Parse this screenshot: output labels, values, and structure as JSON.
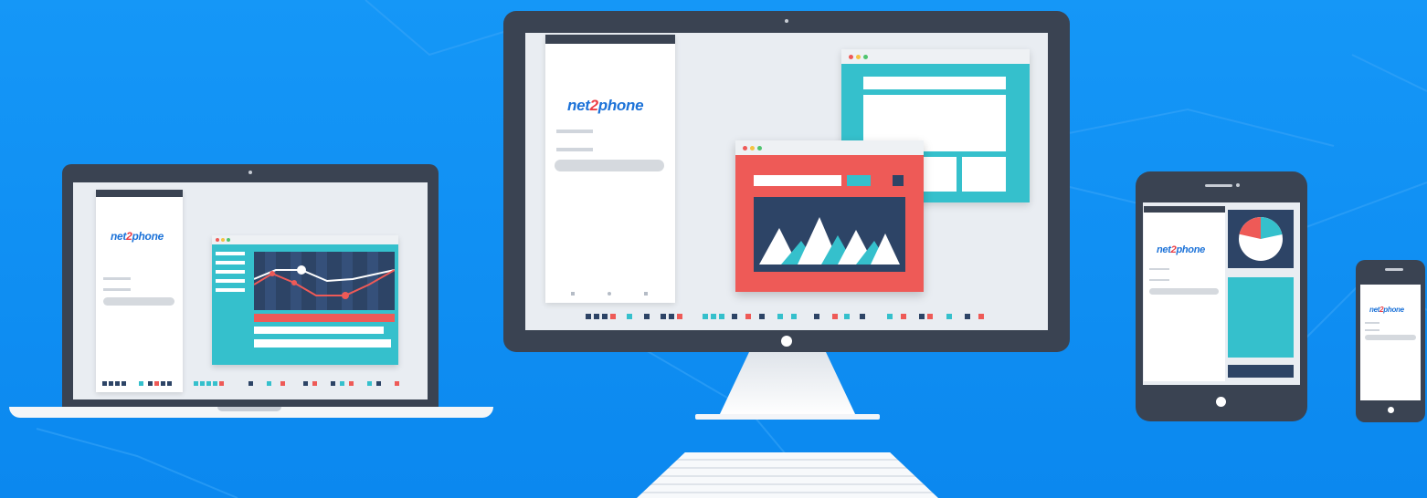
{
  "brand": {
    "name_left": "net",
    "name_digit": "2",
    "name_right": "phone"
  },
  "colors": {
    "background": "#0d8cf2",
    "device_frame": "#3a4352",
    "screen_bg": "#e9edf2",
    "accent_teal": "#35c0cc",
    "accent_red": "#ee5a57",
    "navy": "#2d4466",
    "logo_blue": "#1c72d8",
    "logo_red": "#ec3d44"
  },
  "devices": [
    {
      "name": "laptop",
      "login_panel": {
        "logo": "net2phone"
      },
      "window": "line-chart-app"
    },
    {
      "name": "desktop-monitor",
      "login_panel": {
        "logo": "net2phone"
      },
      "windows": [
        "layout-app",
        "mountain-chart-app"
      ]
    },
    {
      "name": "tablet",
      "login_panel": {
        "logo": "net2phone"
      },
      "content": "pie-chart"
    },
    {
      "name": "phone",
      "login_panel": {
        "logo": "net2phone"
      }
    }
  ],
  "icons": [
    "net2phone-logo",
    "window-dots-icon",
    "home-button-icon",
    "camera-icon",
    "pie-chart-icon",
    "mountain-chart-icon",
    "line-chart-icon"
  ]
}
